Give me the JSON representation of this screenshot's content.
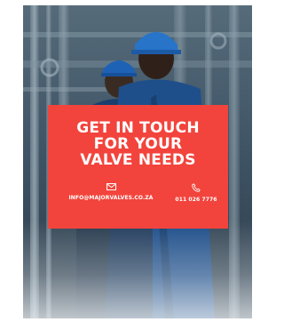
{
  "poster": {
    "headline_lines": [
      "GET IN TOUCH",
      "FOR YOUR",
      "VALVE NEEDS"
    ],
    "email": "INFO@MAJORVALVES.CO.ZA",
    "phone": "011 026 7776",
    "accent_color": "#f2443c",
    "email_icon": "envelope-icon",
    "phone_icon": "phone-icon"
  }
}
